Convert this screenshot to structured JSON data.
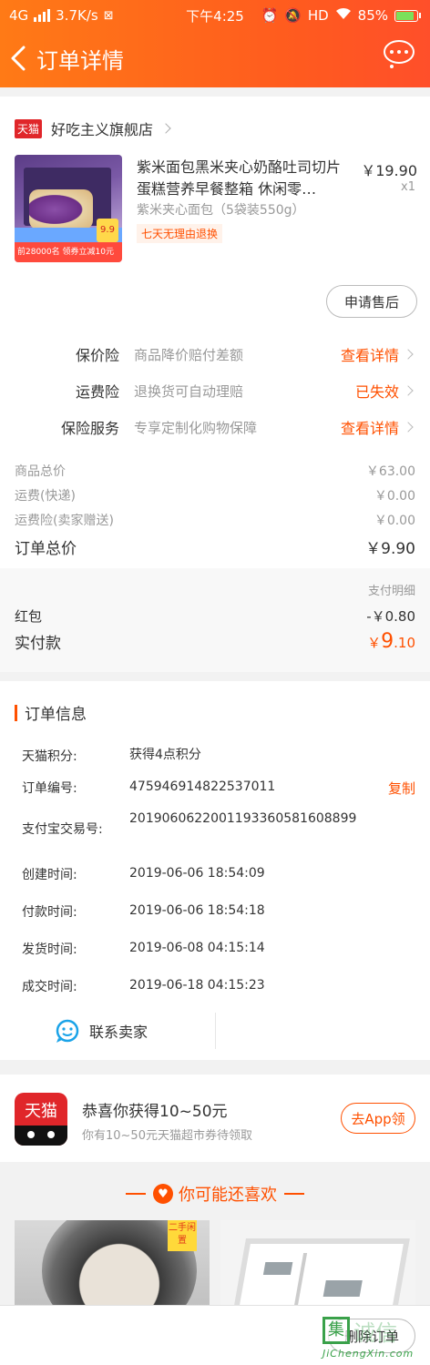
{
  "status_bar": {
    "network": "4G",
    "speed": "3.7K/s",
    "time": "下午4:25",
    "hd": "HD",
    "battery": "85%"
  },
  "nav": {
    "title": "订单详情"
  },
  "shop": {
    "badge": "天猫",
    "name": "好吃主义旗舰店"
  },
  "product": {
    "title": "紫米面包黑米夹心奶酪吐司切片蛋糕营养早餐整箱 休闲零…",
    "spec": "紫米夹心面包（5袋装550g）",
    "tag": "七天无理由退换",
    "price": "￥19.90",
    "qty": "x1",
    "image_text": {
      "promo": "前28000名 领券立减10元",
      "tag": "9.9"
    }
  },
  "after_sale_button": "申请售后",
  "insurance": [
    {
      "label": "保价险",
      "desc": "商品降价赔付差额",
      "action": "查看详情"
    },
    {
      "label": "运费险",
      "desc": "退换货可自动理赔",
      "action": "已失效"
    },
    {
      "label": "保险服务",
      "desc": "专享定制化购物保障",
      "action": "查看详情"
    }
  ],
  "summary": {
    "goods_total_label": "商品总价",
    "goods_total": "￥63.00",
    "shipping_label": "运费(快递)",
    "shipping": "￥0.00",
    "shipping_ins_label": "运费险(卖家赠送)",
    "shipping_ins": "￥0.00",
    "order_total_label": "订单总价",
    "order_total": "￥9.90"
  },
  "payment": {
    "detail_label": "支付明细",
    "redpack_label": "红包",
    "redpack": "-￥0.80",
    "paid_label": "实付款",
    "paid_symbol": "￥",
    "paid_int": "9",
    "paid_dec": ".10"
  },
  "order_info": {
    "title": "订单信息",
    "copy_label": "复制",
    "rows": [
      {
        "k": "天猫积分:",
        "v": "获得4点积分"
      },
      {
        "k": "订单编号:",
        "v": "475946914822537011"
      },
      {
        "k": "支付宝交易号:",
        "v": "2019060622001193360581608899"
      },
      {
        "k": "创建时间:",
        "v": "2019-06-06 18:54:09"
      },
      {
        "k": "付款时间:",
        "v": "2019-06-06 18:54:18"
      },
      {
        "k": "发货时间:",
        "v": "2019-06-08 04:15:14"
      },
      {
        "k": "成交时间:",
        "v": "2019-06-18 04:15:23"
      }
    ],
    "contact_label": "联系卖家"
  },
  "promo": {
    "logo_text": "天猫",
    "title": "恭喜你获得10~50元",
    "sub": "你有10~50元天猫超市券待领取",
    "button": "去App领"
  },
  "recommend": {
    "title": "你可能还喜欢",
    "badge": "二手闲置"
  },
  "bottom": {
    "delete_button": "删除订单"
  },
  "watermark": {
    "char": "集",
    "text": "诚信",
    "url": "JiChengXin.com"
  },
  "colors": {
    "accent": "#ff5000",
    "header_start": "#ff7a16",
    "header_end": "#ff4f2a",
    "tmall_red": "#e0262a"
  }
}
